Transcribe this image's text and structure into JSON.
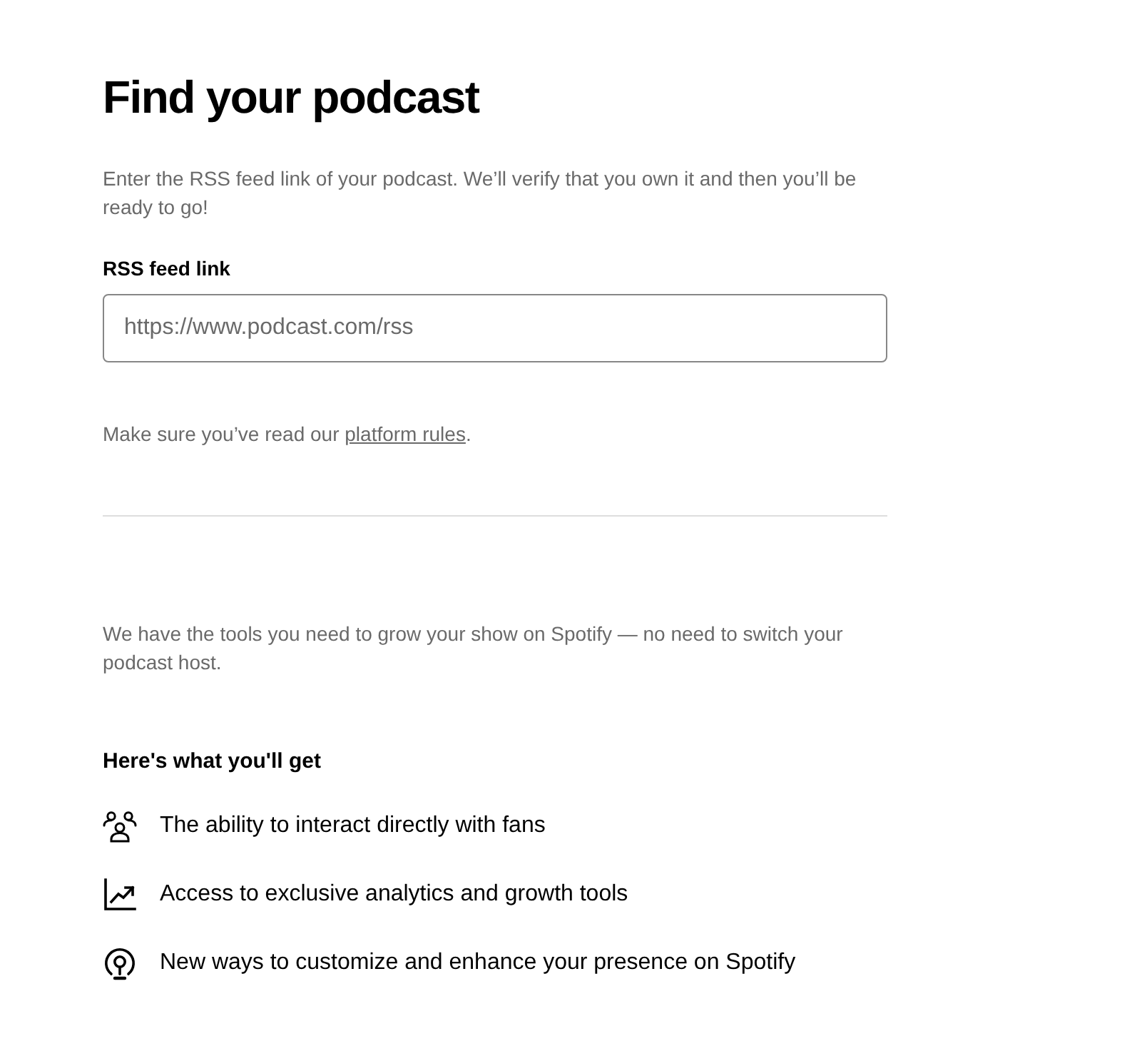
{
  "heading": "Find your podcast",
  "intro": "Enter the RSS feed link of your podcast. We’ll verify that you own it and then you’ll be ready to go!",
  "feed_field": {
    "label": "RSS feed link",
    "placeholder": "https://www.podcast.com/rss"
  },
  "rules_note": {
    "text": "Make sure you’ve read our ",
    "link": "platform rules",
    "end": "."
  },
  "tools_note": "We have the tools you need to grow your show on Spotify — no need to switch your podcast host.",
  "benefits": {
    "title": "Here's what you'll get",
    "items": [
      "The ability to interact directly with fans",
      "Access to exclusive analytics and growth tools",
      "New ways to customize and enhance your presence on Spotify"
    ]
  }
}
